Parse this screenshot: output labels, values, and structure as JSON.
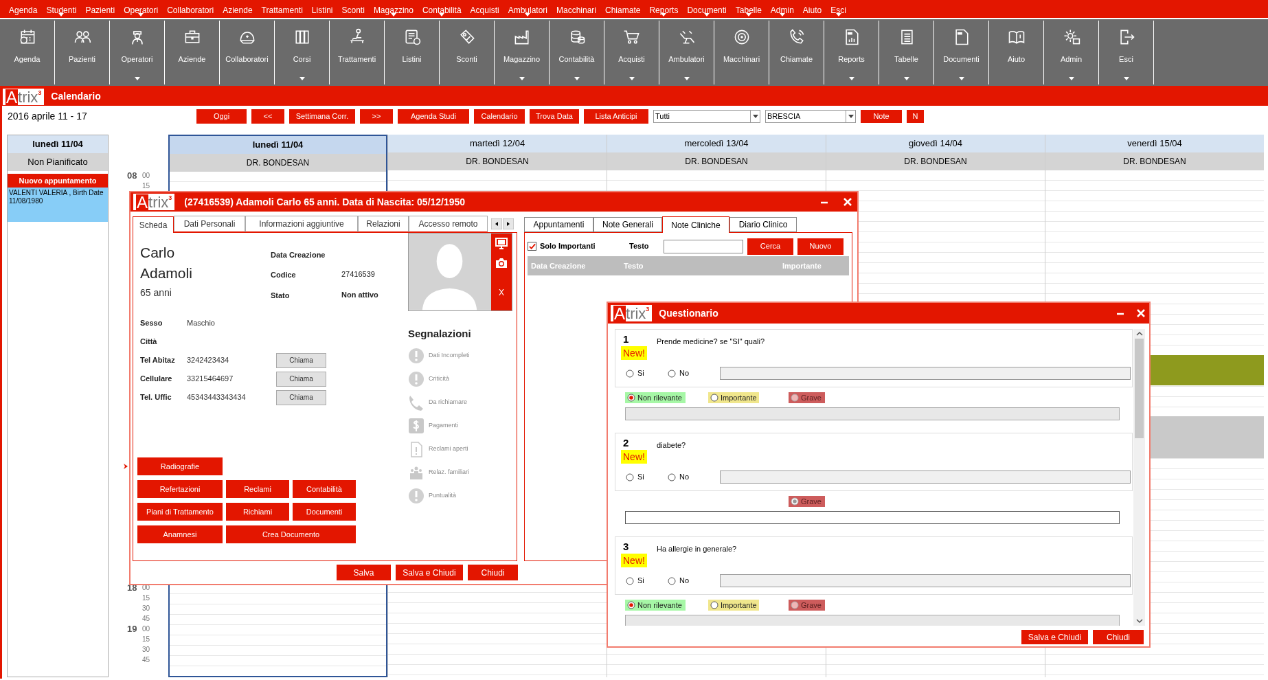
{
  "menu_bar": [
    {
      "label": "Agenda",
      "dropdown": false
    },
    {
      "label": "Studenti",
      "dropdown": true
    },
    {
      "label": "Pazienti",
      "dropdown": false
    },
    {
      "label": "Operatori",
      "dropdown": true
    },
    {
      "label": "Collaboratori",
      "dropdown": false
    },
    {
      "label": "Aziende",
      "dropdown": false
    },
    {
      "label": "Trattamenti",
      "dropdown": false
    },
    {
      "label": "Listini",
      "dropdown": false
    },
    {
      "label": "Sconti",
      "dropdown": false
    },
    {
      "label": "Magazzino",
      "dropdown": true
    },
    {
      "label": "Contabilità",
      "dropdown": true
    },
    {
      "label": "Acquisti",
      "dropdown": false
    },
    {
      "label": "Ambulatori",
      "dropdown": true
    },
    {
      "label": "Macchinari",
      "dropdown": false
    },
    {
      "label": "Chiamate",
      "dropdown": false
    },
    {
      "label": "Reports",
      "dropdown": true
    },
    {
      "label": "Documenti",
      "dropdown": true
    },
    {
      "label": "Tabelle",
      "dropdown": true
    },
    {
      "label": "Admin",
      "dropdown": true
    },
    {
      "label": "Aiuto",
      "dropdown": false
    },
    {
      "label": "Esci",
      "dropdown": true
    }
  ],
  "toolbar": [
    {
      "label": "Agenda",
      "dropdown": false
    },
    {
      "label": "Pazienti",
      "dropdown": false
    },
    {
      "label": "Operatori",
      "dropdown": true
    },
    {
      "label": "Aziende",
      "dropdown": false
    },
    {
      "label": "Collaboratori",
      "dropdown": false
    },
    {
      "label": "Corsi",
      "dropdown": true
    },
    {
      "label": "Trattamenti",
      "dropdown": false
    },
    {
      "label": "Listini",
      "dropdown": false
    },
    {
      "label": "Sconti",
      "dropdown": false
    },
    {
      "label": "Magazzino",
      "dropdown": true
    },
    {
      "label": "Contabilità",
      "dropdown": true
    },
    {
      "label": "Acquisti",
      "dropdown": true
    },
    {
      "label": "Ambulatori",
      "dropdown": true
    },
    {
      "label": "Macchinari",
      "dropdown": false
    },
    {
      "label": "Chiamate",
      "dropdown": false
    },
    {
      "label": "Reports",
      "dropdown": true
    },
    {
      "label": "Tabelle",
      "dropdown": true
    },
    {
      "label": "Documenti",
      "dropdown": true
    },
    {
      "label": "Aiuto",
      "dropdown": false
    },
    {
      "label": "Admin",
      "dropdown": true
    },
    {
      "label": "Esci",
      "dropdown": true
    }
  ],
  "calendar": {
    "logo": {
      "letter": "A",
      "rest": "trix",
      "sup": "3"
    },
    "title": "Calendario",
    "range": "2016 aprile 11 - 17",
    "buttons": [
      "Oggi",
      "<<",
      "Settimana Corr.",
      ">>",
      "Agenda Studi",
      "Calendario",
      "Trova Data",
      "Lista Anticipi"
    ],
    "filter_select": {
      "value": "Tutti"
    },
    "location_select": {
      "value": "BRESCIA"
    },
    "extra_buttons": [
      "Note",
      "N"
    ],
    "side_panel": {
      "day": "lunedì 11/04",
      "group": "Non Pianificato",
      "new_button": "Nuovo appuntamento",
      "entries": [
        "VALENTI VALERIA , Birth Date 11/08/1980"
      ]
    },
    "days": [
      {
        "label": "lunedì 11/04",
        "doctor": "DR. BONDESAN",
        "selected": true
      },
      {
        "label": "martedì 12/04",
        "doctor": "DR. BONDESAN",
        "selected": false
      },
      {
        "label": "mercoledì 13/04",
        "doctor": "DR. BONDESAN",
        "selected": false
      },
      {
        "label": "giovedì 14/04",
        "doctor": "DR. BONDESAN",
        "selected": false
      },
      {
        "label": "venerdì 15/04",
        "doctor": "DR. BONDESAN",
        "selected": false
      }
    ],
    "time_slots": [
      {
        "hour": "08",
        "minutes": [
          "00",
          "15"
        ]
      },
      {
        "hour": "18",
        "minutes": [
          "00",
          "15",
          "30",
          "45"
        ]
      },
      {
        "hour": "19",
        "minutes": [
          "00",
          "15",
          "30",
          "45"
        ]
      }
    ],
    "appointment_blocks": [
      {
        "color": "#8e9a1e"
      },
      {
        "color": "#c9c9c9"
      }
    ]
  },
  "patient_window": {
    "logo": {
      "letter": "A",
      "rest": "trix",
      "sup": "3"
    },
    "title": "(27416539) Adamoli Carlo 65 anni. Data di Nascita: 05/12/1950",
    "tabs": [
      {
        "label": "Scheda",
        "selected": true
      },
      {
        "label": "Dati Personali",
        "selected": false
      },
      {
        "label": "Informazioni aggiuntive",
        "selected": false
      },
      {
        "label": "Relazioni",
        "selected": false
      },
      {
        "label": "Accesso remoto",
        "selected": false
      }
    ],
    "first_name": "Carlo",
    "last_name": "Adamoli",
    "age": "65 anni",
    "info": [
      {
        "label": "Data Creazione"
      },
      {
        "label": "Codice",
        "value": "27416539"
      },
      {
        "label": "Stato",
        "value": "Non attivo"
      }
    ],
    "photo_close": "X",
    "details": [
      {
        "label": "Sesso",
        "value": "Maschio"
      },
      {
        "label": "Città"
      },
      {
        "label": "Tel Abitaz",
        "value": "3242423434",
        "call": "Chiama"
      },
      {
        "label": "Cellulare",
        "value": "33215464697",
        "call": "Chiama"
      },
      {
        "label": "Tel. Uffic",
        "value": "45343443343434",
        "call": "Chiama"
      }
    ],
    "alerts_title": "Segnalazioni",
    "alerts": [
      "Dati Incompleti",
      "Criticità",
      "Da richiamare",
      "Pagamenti",
      "Reclami aperti",
      "Relaz. familiari",
      "Puntualità"
    ],
    "action_buttons": [
      [
        "Radiografie"
      ],
      [
        "Refertazioni",
        "Reclami",
        "Contabilità"
      ],
      [
        "Piani di Trattamento",
        "Richiami",
        "Documenti"
      ],
      [
        "Anamnesi",
        "Crea Documento"
      ]
    ],
    "notes_tabs": [
      {
        "label": "Appuntamenti",
        "selected": false
      },
      {
        "label": "Note Generali",
        "selected": false
      },
      {
        "label": "Note Cliniche",
        "selected": true
      },
      {
        "label": "Diario Clinico",
        "selected": false
      }
    ],
    "only_important": {
      "label": "Solo Importanti",
      "checked": true
    },
    "search_label": "Testo",
    "search_buttons": [
      "Cerca",
      "Nuovo"
    ],
    "notes_columns": [
      "Data Creazione",
      "Testo",
      "Importante"
    ],
    "footer_buttons": [
      "Salva",
      "Salva e Chiudi",
      "Chiudi"
    ]
  },
  "questionnaire": {
    "logo": {
      "letter": "A",
      "rest": "trix",
      "sup": "3"
    },
    "title": "Questionario",
    "questions": [
      {
        "number": "1",
        "badge": "New!",
        "text": "Prende medicine? se \"SI\" quali?",
        "answers": [
          {
            "label": "Si",
            "selected": false
          },
          {
            "label": "No",
            "selected": false
          }
        ],
        "note_enabled": false,
        "severity": [
          {
            "kind": "low",
            "label": "Non rilevante",
            "color": "#a6f7a6",
            "selected": true,
            "disabled": false
          },
          {
            "kind": "mid",
            "label": "Importante",
            "color": "#f0e68c",
            "selected": false,
            "disabled": false
          },
          {
            "kind": "high",
            "label": "Grave",
            "color": "#cd5c5c",
            "selected": false,
            "disabled": true
          }
        ]
      },
      {
        "number": "2",
        "badge": "New!",
        "text": "diabete?",
        "answers": [
          {
            "label": "Si",
            "selected": false
          },
          {
            "label": "No",
            "selected": false
          }
        ],
        "note_enabled": true,
        "severity": [
          {
            "kind": "high",
            "label": "Grave",
            "color": "#cd5c5c",
            "selected": true,
            "disabled": true
          }
        ]
      },
      {
        "number": "3",
        "badge": "New!",
        "text": "Ha allergie in generale?",
        "answers": [
          {
            "label": "Si",
            "selected": false
          },
          {
            "label": "No",
            "selected": false
          }
        ],
        "note_enabled": false,
        "severity": [
          {
            "kind": "low",
            "label": "Non rilevante",
            "color": "#a6f7a6",
            "selected": true,
            "disabled": false
          },
          {
            "kind": "mid",
            "label": "Importante",
            "color": "#f0e68c",
            "selected": false,
            "disabled": false
          },
          {
            "kind": "high",
            "label": "Grave",
            "color": "#cd5c5c",
            "selected": false,
            "disabled": true
          }
        ]
      }
    ],
    "footer_buttons": [
      "Salva e Chiudi",
      "Chiudi"
    ]
  }
}
